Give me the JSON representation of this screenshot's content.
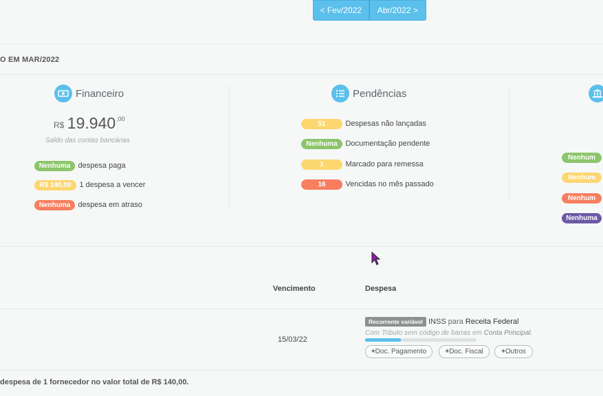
{
  "nav": {
    "prev_label": "< Fev/2022",
    "next_label": "Abr/2022 >"
  },
  "section_title": "O EM MAR/2022",
  "financeiro": {
    "title": "Financeiro",
    "currency": "R$",
    "balance": "19.940",
    "cents": ",00",
    "caption": "Saldo das contas bancárias",
    "rows": [
      {
        "badge": "Nenhuma",
        "text": "despesa paga",
        "color": "#8cc56b"
      },
      {
        "badge": "R$ 140,00",
        "text": "1 despesa a vencer",
        "color": "#fcd770"
      },
      {
        "badge": "Nenhuma",
        "text": "despesa em atraso",
        "color": "#f77f5f"
      }
    ]
  },
  "pendencias": {
    "title": "Pendências",
    "rows": [
      {
        "badge": "51",
        "text": "Despesas não lançadas",
        "color": "#fcd770"
      },
      {
        "badge": "Nenhuma",
        "text": "Documentação pendente",
        "color": "#8cc56b"
      },
      {
        "badge": "1",
        "text": "Marcado para remessa",
        "color": "#fcd770"
      },
      {
        "badge": "16",
        "text": "Vencidas no mês passado",
        "color": "#f77f5f"
      }
    ]
  },
  "third_panel": {
    "badges": [
      {
        "label": "Nenhum",
        "color": "#8cc56b"
      },
      {
        "label": "Nenhum",
        "color": "#fcd770"
      },
      {
        "label": "Nenhum",
        "color": "#f77f5f"
      },
      {
        "label": "Nenhuma",
        "color": "#6c58a6"
      }
    ]
  },
  "table": {
    "headers": {
      "vencimento": "Vencimento",
      "despesa": "Despesa"
    },
    "row": {
      "date": "15/03/22",
      "tag": "Recorrente variável",
      "desc_prefix": "INSS",
      "desc_para": "para",
      "payee": "Receita Federal",
      "sub_a": "Com Tributo sem código de barras em",
      "sub_b": "Conta Principal.",
      "progress": 0.32,
      "docs": [
        "Doc. Pagamento",
        "Doc. Fiscal",
        "Outros"
      ]
    }
  },
  "footer": "despesa de 1 fornecedor no valor total de R$ 140,00."
}
